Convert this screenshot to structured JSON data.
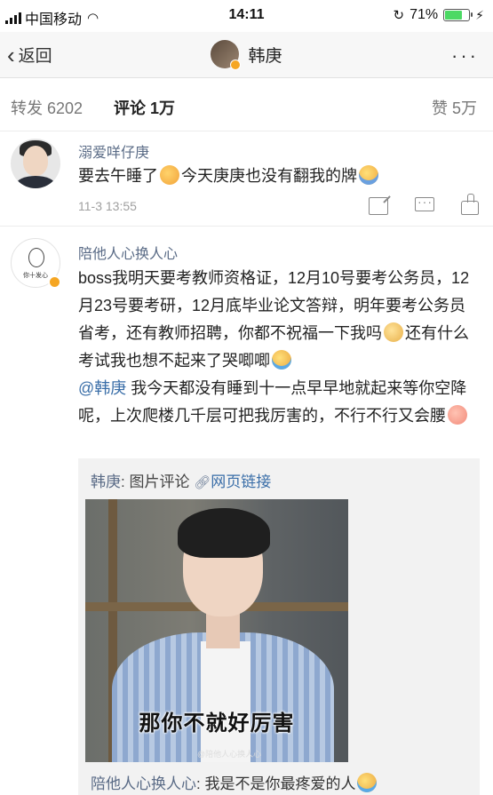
{
  "status_bar": {
    "carrier": "中国移动",
    "time": "14:11",
    "battery_percent": "71%",
    "battery_level": 0.71,
    "accent_battery": "#4cd964"
  },
  "nav": {
    "back_label": "返回",
    "title": "韩庚",
    "more_label": "···"
  },
  "tabs": {
    "repost": "转发 6202",
    "comments": "评论 1万",
    "likes": "赞 5万"
  },
  "comments": [
    {
      "name": "溺爱咩仔庚",
      "text_a": "要去午睡了",
      "text_b": "今天庚庚也没有翻我的牌",
      "time": "11-3 13:55"
    },
    {
      "name": "陪他人心换人心",
      "avatar_caption": "你十发心",
      "text_a": "boss我明天要考教师资格证，12月10号要考公务员，12月23号要考研，12月底毕业论文答辩，明年要考公务员省考，还有教师招聘，你都不祝福一下我吗",
      "text_b": "还有什么考试我也想不起来了哭唧唧",
      "mention": "@韩庚",
      "text_c": " 我今天都没有睡到十一点早早地就起来等你空降呢，上次爬楼几千层可把我厉害的，不行不行又会腰"
    }
  ],
  "quoted_card": {
    "author": "韩庚",
    "type_label": ": 图片评论",
    "link_label": "网页链接",
    "image_caption": "那你不就好厉害",
    "watermark": "@陪他人心换人心",
    "sub_author": "陪他人心换人心",
    "sub_text": ": 我是不是你最疼爱的人"
  }
}
